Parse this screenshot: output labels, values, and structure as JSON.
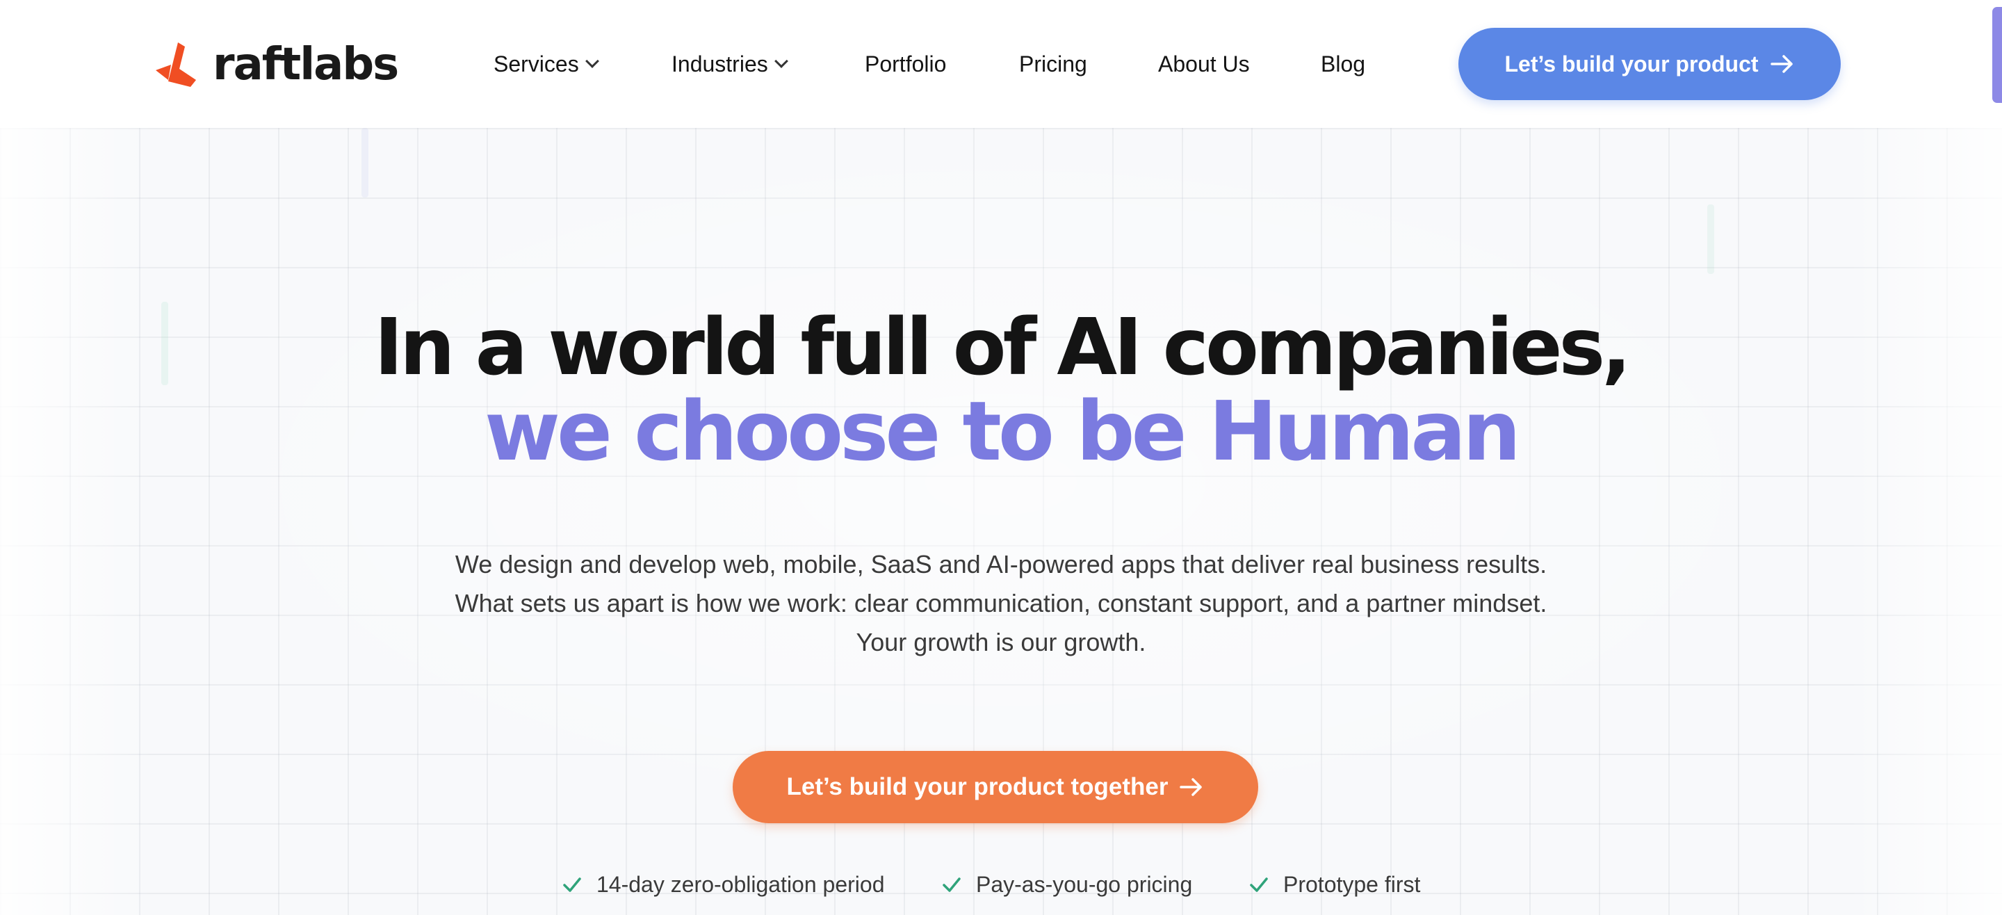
{
  "brand": {
    "name": "raftlabs",
    "logo_color": "#f04e23"
  },
  "nav": {
    "items": [
      {
        "label": "Services",
        "has_dropdown": true
      },
      {
        "label": "Industries",
        "has_dropdown": true
      },
      {
        "label": "Portfolio",
        "has_dropdown": false
      },
      {
        "label": "Pricing",
        "has_dropdown": false
      },
      {
        "label": "About Us",
        "has_dropdown": false
      },
      {
        "label": "Blog",
        "has_dropdown": false
      }
    ],
    "cta_label": "Let’s build your product",
    "cta_color": "#5b87e6",
    "cta_icon": "arrow-right-icon"
  },
  "hero": {
    "headline_line1": "In a world full of AI companies,",
    "headline_line2": "we choose to be Human",
    "headline_line2_color": "#7b7be0",
    "description": [
      "We design and develop web, mobile, SaaS and AI-powered apps that deliver real business results.",
      "What sets us apart is how we work: clear communication, constant support, and a partner mindset.",
      "Your growth is our growth."
    ],
    "cta_label": "Let’s build your product together",
    "cta_color": "#f07b45",
    "cta_icon": "arrow-right-icon",
    "features": [
      {
        "label": "14-day zero-obligation period",
        "icon": "check-icon"
      },
      {
        "label": "Pay-as-you-go pricing",
        "icon": "check-icon"
      },
      {
        "label": "Prototype first",
        "icon": "check-icon"
      }
    ],
    "check_color": "#2fa37a"
  }
}
